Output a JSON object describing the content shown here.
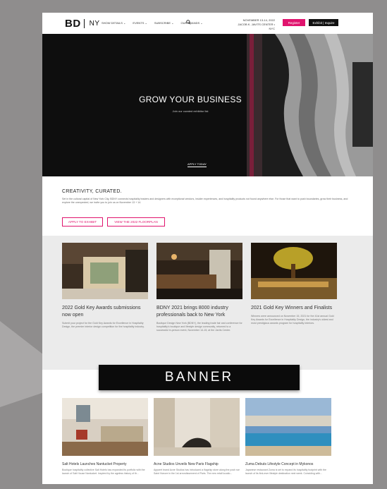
{
  "header": {
    "logo_bd": "BD",
    "logo_ny": "NY",
    "nav": [
      "SHOW DETAILS ⌄",
      "EVENTS ⌄",
      "SUBSCRIBE ⌄",
      "OUR BRANDS ⌄"
    ],
    "event_date": "NOVEMBER 13-14, 2022",
    "event_venue": "JACOB K. JAVITS CENTER • NYC",
    "register_label": "Register",
    "exhibit_label": "Exhibit | Inquire"
  },
  "hero": {
    "title": "GROW YOUR BUSINESS",
    "subtitle": "Join our curated exhibitor list",
    "cta": "APPLY TODAY"
  },
  "creativity": {
    "title": "CREATIVITY, CURATED.",
    "text": "Set in the cultural capital of New York City, BDNY connects hospitality leaders and designers with exceptional vendors, insider experiences, and hospitality products not found anywhere else. For those that want to push boundaries, grow their business, and explore the unexpected, we invite you to join us on November 13 + 14.",
    "btn1": "APPLY TO EXHIBIT",
    "btn2": "VIEW THE 2022 FLOORPLAN"
  },
  "news": [
    {
      "title": "2022 Gold Key Awards submissions now open",
      "body": "Submit your project for the Gold Key Awards for Excellence in Hospitality Design, the premier interior design competition for the hospitality industry."
    },
    {
      "title": "BDNY 2021 brings 8000 industry professionals back to New York",
      "body": "Boutique Design New York (BDNY), the leading trade fair and conference for hospitality's boutique and lifestyle design community, returned to a successful in-person event, November 14-15, at the Javits Center."
    },
    {
      "title": "2021 Gold Key Winners and Finalists",
      "body": "Winners were announced on November 15, 2021 for the 41st annual Gold Key Awards for Excellence in Hospitality Design, the industry's oldest and most prestigious awards program for hospitality interiors."
    }
  ],
  "banner": {
    "label": "BANNER"
  },
  "row2": [
    {
      "title": "Salt Hotels Launches Nantucket Property",
      "body": "Boutique hospitality collective Salt Hotels has expanded its portfolio with the launch of Salt House Nantucket. Inspired by the ageless history of th..."
    },
    {
      "title": "Acne Studios Unveils New Paris Flagship",
      "body": "Apparel brand Acne Studios has introduced a flagship store along the posh rue Saint Honore in the 1st arrondissement of Paris. The new retail locatio..."
    },
    {
      "title": "Zuma Debuts Lifestyle Concept in Mykonos",
      "body": "Japanese restaurant Zuma is set to expand its hospitality footprint with the launch of its first-ever lifestyle destination next week. Coinciding with..."
    }
  ],
  "colors": {
    "accent": "#e0146e",
    "frame": "#8f8d8d",
    "hero_bg": "#0e0e0e",
    "news_bg": "#ebebeb"
  }
}
